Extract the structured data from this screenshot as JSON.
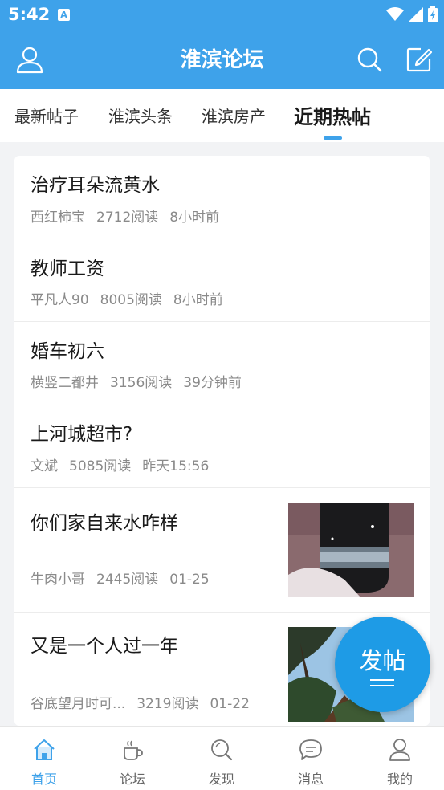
{
  "status_bar": {
    "time": "5:42",
    "notification_badge": "A"
  },
  "app_bar": {
    "title": "淮滨论坛"
  },
  "tabs": [
    {
      "label": "最新帖子",
      "active": false
    },
    {
      "label": "淮滨头条",
      "active": false
    },
    {
      "label": "淮滨房产",
      "active": false
    },
    {
      "label": "近期热帖",
      "active": true
    }
  ],
  "posts": [
    {
      "title": "治疗耳朵流黄水",
      "author": "西红柿宝",
      "reads": "2712阅读",
      "time": "8小时前",
      "has_image": false
    },
    {
      "title": "教师工资",
      "author": "平凡人90",
      "reads": "8005阅读",
      "time": "8小时前",
      "has_image": false
    },
    {
      "title": "婚车初六",
      "author": "横竖二都井",
      "reads": "3156阅读",
      "time": "39分钟前",
      "has_image": false
    },
    {
      "title": "上河城超市?",
      "author": "文斌",
      "reads": "5085阅读",
      "time": "昨天15:56",
      "has_image": false
    },
    {
      "title": "你们家自来水咋样",
      "author": "牛肉小哥",
      "reads": "2445阅读",
      "time": "01-25",
      "has_image": true
    },
    {
      "title": "又是一个人过一年",
      "author": "谷底望月时可...",
      "reads": "3219阅读",
      "time": "01-22",
      "has_image": true
    }
  ],
  "fab": {
    "label": "发帖"
  },
  "bottom_nav": [
    {
      "label": "首页",
      "icon": "home-icon",
      "active": true
    },
    {
      "label": "论坛",
      "icon": "coffee-cup-icon",
      "active": false
    },
    {
      "label": "发现",
      "icon": "search-icon",
      "active": false
    },
    {
      "label": "消息",
      "icon": "message-icon",
      "active": false
    },
    {
      "label": "我的",
      "icon": "user-icon",
      "active": false
    }
  ],
  "colors": {
    "primary": "#3ea2ea",
    "fab": "#1e9be6",
    "meta_text": "#8a8a8a"
  }
}
